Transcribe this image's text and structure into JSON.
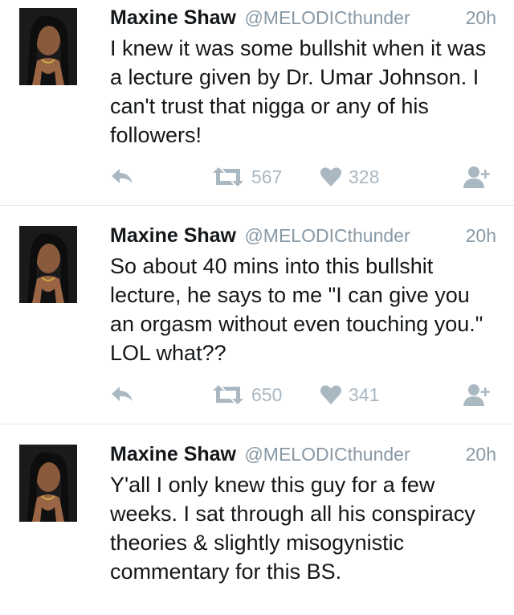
{
  "tweets": [
    {
      "name": "Maxine Shaw",
      "handle": "@MELODICthunder",
      "time": "20h",
      "text": "I knew it was some bullshit when it was a lecture given by Dr. Umar Johnson. I can't trust that nigga or any of his followers!",
      "retweets": "567",
      "likes": "328"
    },
    {
      "name": "Maxine Shaw",
      "handle": "@MELODICthunder",
      "time": "20h",
      "text": "So about 40 mins into this bullshit lecture, he says to me \"I can give you an orgasm without even touching you.\" LOL what??",
      "retweets": "650",
      "likes": "341"
    },
    {
      "name": "Maxine Shaw",
      "handle": "@MELODICthunder",
      "time": "20h",
      "text": "Y'all I only knew this guy for a few weeks. I sat through all his conspiracy theories & slightly misogynistic commentary for this BS."
    }
  ],
  "icons": {
    "reply": "reply-icon",
    "retweet": "retweet-icon",
    "like": "heart-icon",
    "follow": "follow-user-icon"
  },
  "colors": {
    "text": "#14171a",
    "secondary": "#8899a6",
    "icon": "#aab8c2",
    "divider": "#e1e8ed"
  }
}
